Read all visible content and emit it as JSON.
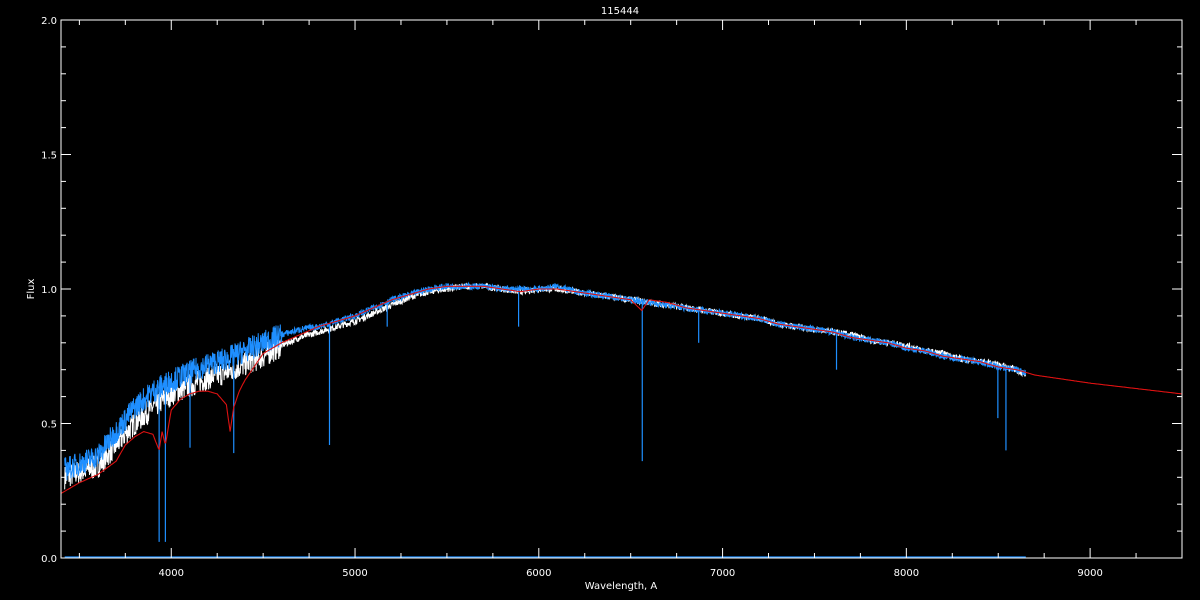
{
  "chart_data": {
    "type": "line",
    "title": "115444",
    "xlabel": "Wavelength, A",
    "ylabel": "Flux",
    "xlim": [
      3400,
      9500
    ],
    "ylim": [
      0.0,
      2.0
    ],
    "x_major_ticks": [
      4000,
      5000,
      6000,
      7000,
      8000,
      9000
    ],
    "x_tick_labels": [
      "4000",
      "5000",
      "6000",
      "7000",
      "8000",
      "9000"
    ],
    "y_major_ticks": [
      0.0,
      0.5,
      1.0,
      1.5,
      2.0
    ],
    "y_tick_labels": [
      "0.0",
      "0.5",
      "1.0",
      "1.5",
      "2.0"
    ],
    "grid": false,
    "background": "#000000",
    "series": [
      {
        "color": "#ffffff",
        "style": "noisy observed spectrum",
        "x": [
          3420,
          3500,
          3600,
          3700,
          3800,
          3900,
          4000,
          4100,
          4200,
          4300,
          4400,
          4500,
          4600,
          4700,
          4800,
          4900,
          5000,
          5100,
          5200,
          5300,
          5400,
          5500,
          5600,
          5700,
          5800,
          5900,
          6000,
          6100,
          6200,
          6300,
          6400,
          6500,
          6600,
          6700,
          6800,
          6900,
          7000,
          7100,
          7200,
          7300,
          7400,
          7500,
          7600,
          7700,
          7800,
          7900,
          8000,
          8100,
          8200,
          8300,
          8400,
          8500,
          8600,
          8650
        ],
        "y": [
          0.3,
          0.32,
          0.34,
          0.42,
          0.5,
          0.56,
          0.61,
          0.64,
          0.67,
          0.69,
          0.72,
          0.75,
          0.79,
          0.82,
          0.84,
          0.86,
          0.88,
          0.91,
          0.94,
          0.97,
          0.99,
          1.0,
          1.01,
          1.01,
          1.0,
          0.99,
          1.0,
          1.0,
          0.99,
          0.98,
          0.97,
          0.96,
          0.95,
          0.94,
          0.93,
          0.92,
          0.91,
          0.9,
          0.89,
          0.87,
          0.86,
          0.85,
          0.84,
          0.83,
          0.81,
          0.8,
          0.79,
          0.77,
          0.76,
          0.74,
          0.73,
          0.72,
          0.7,
          0.68
        ]
      },
      {
        "color": "#1f8fff",
        "style": "noisy spectrum with absorption lines",
        "x": [
          3420,
          3500,
          3600,
          3700,
          3800,
          3900,
          4000,
          4100,
          4200,
          4300,
          4400,
          4500,
          4600,
          4700,
          4800,
          4900,
          5000,
          5100,
          5200,
          5300,
          5400,
          5500,
          5600,
          5700,
          5800,
          5900,
          6000,
          6100,
          6200,
          6300,
          6400,
          6500,
          6600,
          6700,
          6800,
          6900,
          7000,
          7100,
          7200,
          7300,
          7400,
          7500,
          7600,
          7700,
          7800,
          7900,
          8000,
          8100,
          8200,
          8300,
          8400,
          8500,
          8600,
          8650
        ],
        "y": [
          0.33,
          0.35,
          0.38,
          0.47,
          0.56,
          0.62,
          0.66,
          0.69,
          0.72,
          0.74,
          0.77,
          0.8,
          0.83,
          0.85,
          0.86,
          0.88,
          0.9,
          0.93,
          0.96,
          0.98,
          1.0,
          1.01,
          1.01,
          1.01,
          1.0,
          1.0,
          1.0,
          1.01,
          0.99,
          0.98,
          0.97,
          0.96,
          0.95,
          0.94,
          0.93,
          0.92,
          0.91,
          0.9,
          0.89,
          0.87,
          0.86,
          0.85,
          0.84,
          0.82,
          0.81,
          0.8,
          0.78,
          0.77,
          0.75,
          0.74,
          0.73,
          0.71,
          0.7,
          0.69
        ],
        "absorption_lines": [
          {
            "x": 3934,
            "y": 0.06
          },
          {
            "x": 3968,
            "y": 0.06
          },
          {
            "x": 4102,
            "y": 0.41
          },
          {
            "x": 4340,
            "y": 0.39
          },
          {
            "x": 4861,
            "y": 0.42
          },
          {
            "x": 5175,
            "y": 0.86
          },
          {
            "x": 5890,
            "y": 0.86
          },
          {
            "x": 6563,
            "y": 0.36
          },
          {
            "x": 6870,
            "y": 0.8
          },
          {
            "x": 7620,
            "y": 0.7
          },
          {
            "x": 8498,
            "y": 0.52
          },
          {
            "x": 8542,
            "y": 0.4
          }
        ],
        "baseline": 0.0
      },
      {
        "color": "#dd1111",
        "style": "smooth model",
        "x": [
          3400,
          3500,
          3600,
          3700,
          3750,
          3800,
          3850,
          3900,
          3934,
          3950,
          3968,
          4000,
          4050,
          4100,
          4150,
          4200,
          4250,
          4300,
          4320,
          4340,
          4370,
          4400,
          4450,
          4500,
          4600,
          4700,
          4800,
          4900,
          5000,
          5100,
          5200,
          5300,
          5400,
          5500,
          5600,
          5700,
          5800,
          5900,
          6000,
          6100,
          6200,
          6300,
          6400,
          6500,
          6560,
          6600,
          6700,
          6800,
          6900,
          7000,
          7100,
          7200,
          7300,
          7400,
          7500,
          7600,
          7700,
          7800,
          7900,
          8000,
          8100,
          8200,
          8300,
          8400,
          8500,
          8600,
          8700,
          9000,
          9500
        ],
        "y": [
          0.24,
          0.28,
          0.31,
          0.36,
          0.42,
          0.45,
          0.47,
          0.46,
          0.4,
          0.47,
          0.42,
          0.55,
          0.59,
          0.61,
          0.62,
          0.62,
          0.61,
          0.57,
          0.47,
          0.56,
          0.62,
          0.66,
          0.71,
          0.76,
          0.8,
          0.83,
          0.86,
          0.88,
          0.9,
          0.93,
          0.96,
          0.98,
          1.0,
          1.01,
          1.01,
          1.01,
          1.0,
          0.99,
          1.0,
          1.0,
          0.99,
          0.98,
          0.97,
          0.96,
          0.92,
          0.96,
          0.95,
          0.93,
          0.92,
          0.91,
          0.9,
          0.89,
          0.87,
          0.86,
          0.85,
          0.84,
          0.82,
          0.81,
          0.8,
          0.78,
          0.77,
          0.75,
          0.74,
          0.73,
          0.71,
          0.7,
          0.68,
          0.65,
          0.61
        ]
      }
    ]
  }
}
